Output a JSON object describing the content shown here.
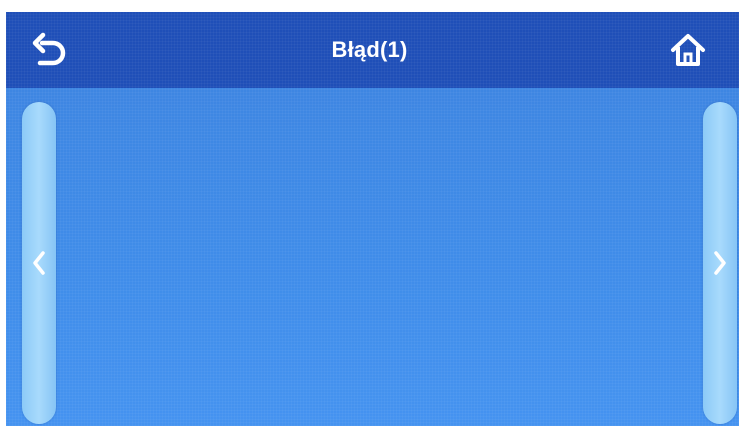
{
  "header": {
    "title": "Błąd(1)",
    "back_icon": "back-arrow-icon",
    "home_icon": "home-icon",
    "bar_color": "#1f4fb8"
  },
  "content": {
    "background_color": "#3f8ce9"
  },
  "navigation": {
    "prev_icon": "chevron-left-icon",
    "next_icon": "chevron-right-icon",
    "side_button_color": "#9bd3fa"
  }
}
